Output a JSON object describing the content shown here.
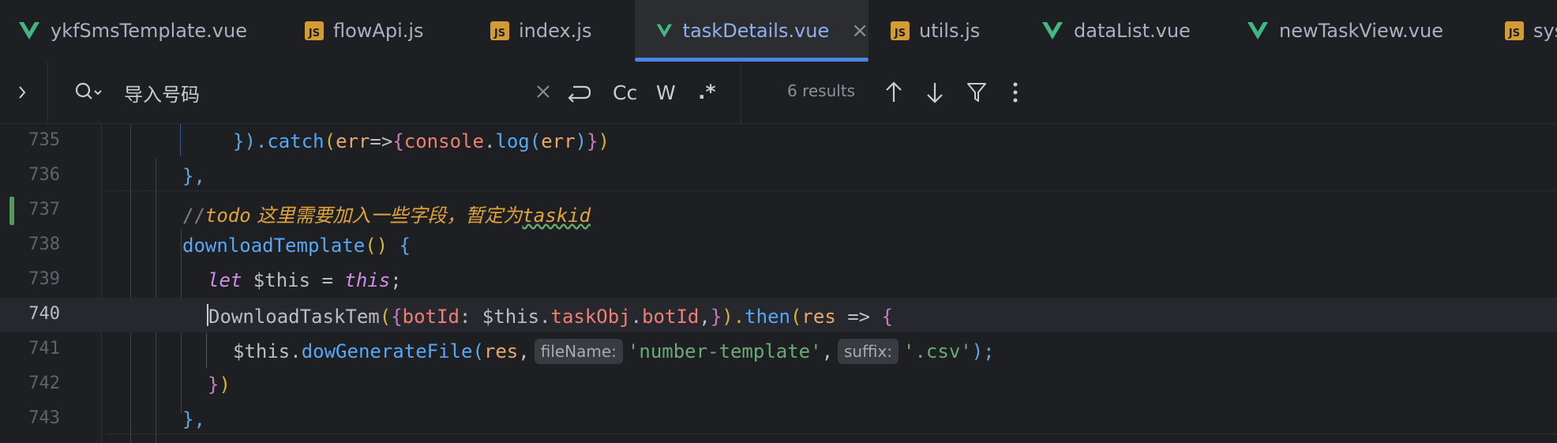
{
  "tabs": [
    {
      "label": "ykfSmsTemplate.vue",
      "icon": "vue-icon",
      "active": false
    },
    {
      "label": "flowApi.js",
      "icon": "js-icon",
      "active": false
    },
    {
      "label": "index.js",
      "icon": "js-icon",
      "active": false
    },
    {
      "label": "taskDetails.vue",
      "icon": "vue-icon",
      "active": true
    },
    {
      "label": "utils.js",
      "icon": "js-icon",
      "active": false
    },
    {
      "label": "dataList.vue",
      "icon": "vue-icon",
      "active": false
    },
    {
      "label": "newTaskView.vue",
      "icon": "vue-icon",
      "active": false
    },
    {
      "label": "sys",
      "icon": "js-icon",
      "active": false
    }
  ],
  "js_icon_text": "JS",
  "find": {
    "query": "导入号码",
    "match_case": "Cc",
    "words": "W",
    "regex": ".*",
    "results": "6 results"
  },
  "line_numbers": [
    "735",
    "736",
    "737",
    "738",
    "739",
    "740",
    "741",
    "742",
    "743"
  ],
  "code": {
    "l735": {
      "a": "}).",
      "b": "catch",
      "c": "(",
      "d": "err",
      "e": "=>",
      "f": "{",
      "g": "console",
      "h": ".",
      "i": "log",
      "j": "(",
      "k": "err",
      "l": ")",
      "m": "}",
      "n": ")"
    },
    "l736": {
      "a": "},"
    },
    "l737": {
      "a": "//",
      "b": "todo",
      "c": " 这里需要加入一些字段，暂定为",
      "d": "taskid"
    },
    "l738": {
      "a": "downloadTemplate",
      "b": "() ",
      "c": "{"
    },
    "l739": {
      "a": "let",
      "b": " $this = ",
      "c": "this",
      "d": ";"
    },
    "l740": {
      "a": "DownloadTaskTem",
      "b": "(",
      "c": "{",
      "d": "botId",
      "e": ": $this.",
      "f": "taskObj",
      "g": ".",
      "h": "botId",
      "i": ",",
      "j": "}",
      "k": ").",
      "l": "then",
      "m": "(",
      "n": "res",
      "o": " => ",
      "p": "{"
    },
    "l741": {
      "a": "$this.",
      "b": "dowGenerateFile",
      "c": "(",
      "d": "res",
      "e": ",",
      "hint1": "fileName:",
      "f": "'number-template'",
      "g": ",",
      "hint2": "suffix:",
      "h": "'.csv'",
      "i": ");"
    },
    "l742": {
      "a": "}",
      "b": ")"
    },
    "l743": {
      "a": "},"
    }
  }
}
